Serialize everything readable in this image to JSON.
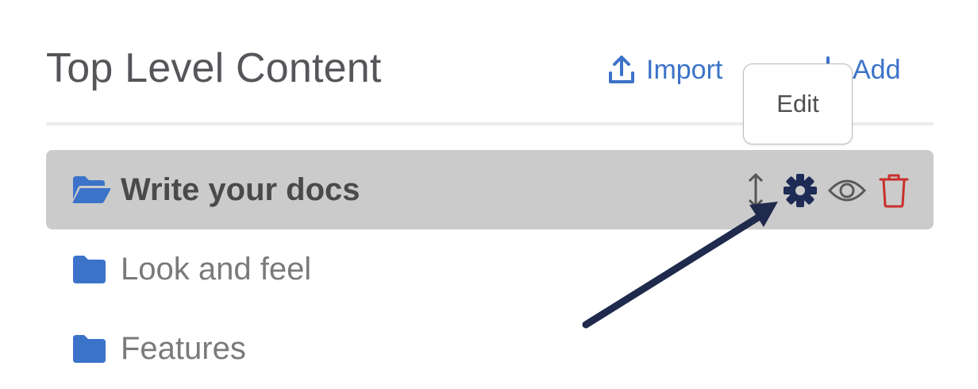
{
  "header": {
    "title": "Top Level Content",
    "import_label": "Import",
    "add_label": "Add"
  },
  "tooltip": {
    "text": "Edit"
  },
  "tree": {
    "items": [
      {
        "label": "Write your docs",
        "selected": true,
        "icon": "folder-open-icon"
      },
      {
        "label": "Look and feel",
        "selected": false,
        "icon": "folder-icon"
      },
      {
        "label": "Features",
        "selected": false,
        "icon": "folder-icon"
      }
    ]
  },
  "colors": {
    "accent": "#3b73c9",
    "selected_row": "#cbcbcb",
    "delete": "#c9302c",
    "gear": "#1d2b55",
    "annotation_arrow": "#1f2a4d"
  }
}
